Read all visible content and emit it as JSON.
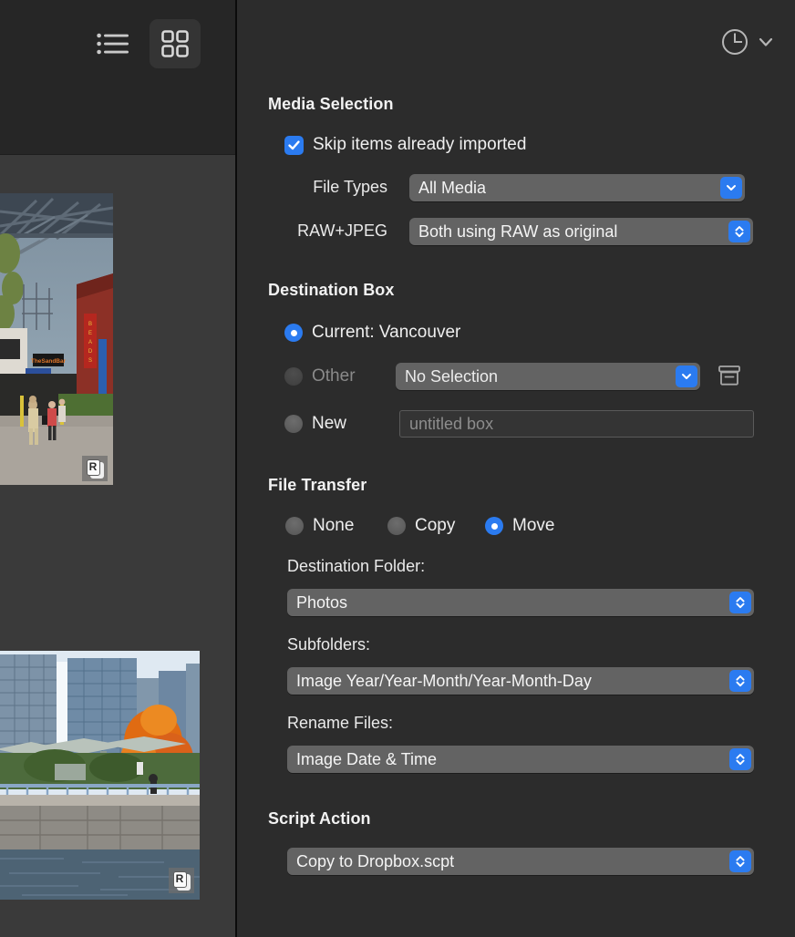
{
  "sidebar": {
    "view_toggle": {
      "list_icon": "list-view-icon",
      "grid_icon": "grid-view-icon",
      "selected": "grid"
    },
    "thumbnails": [
      {
        "name": "granville-island-street-scene",
        "raw_badge": "R"
      },
      {
        "name": "vancouver-seawall-towers",
        "raw_badge": "R"
      }
    ]
  },
  "panel": {
    "history_button": {
      "icon": "clock-icon",
      "chevron": "chevron-down-icon"
    },
    "media_selection": {
      "title": "Media Selection",
      "skip_checkbox": {
        "label": "Skip items already imported",
        "checked": true
      },
      "file_types": {
        "label": "File Types",
        "value": "All Media",
        "arrow": "chevron-down-icon"
      },
      "raw_jpeg": {
        "label": "RAW+JPEG",
        "value": "Both using RAW as original",
        "arrow": "up-down-chevron-icon"
      }
    },
    "destination_box": {
      "title": "Destination Box",
      "current": {
        "label": "Current: Vancouver",
        "selected": true
      },
      "other": {
        "label": "Other",
        "selected": false,
        "disabled": true,
        "value": "No Selection",
        "arrow": "chevron-down-icon",
        "archive_icon": "archive-box-icon"
      },
      "new": {
        "label": "New",
        "selected": false,
        "placeholder": "untitled box",
        "value": ""
      }
    },
    "file_transfer": {
      "title": "File Transfer",
      "options": [
        {
          "label": "None",
          "selected": false
        },
        {
          "label": "Copy",
          "selected": false
        },
        {
          "label": "Move",
          "selected": true
        }
      ],
      "destination_folder": {
        "label": "Destination Folder:",
        "value": "Photos",
        "arrow": "up-down-chevron-icon"
      },
      "subfolders": {
        "label": "Subfolders:",
        "value": "Image Year/Year-Month/Year-Month-Day",
        "arrow": "up-down-chevron-icon"
      },
      "rename_files": {
        "label": "Rename Files:",
        "value": "Image Date & Time",
        "arrow": "up-down-chevron-icon"
      }
    },
    "script_action": {
      "title": "Script Action",
      "script": {
        "value": "Copy to Dropbox.scpt",
        "arrow": "up-down-chevron-icon"
      }
    }
  },
  "colors": {
    "accent": "#2b7bf0",
    "panel_bg": "#2c2c2c",
    "sidebar_bg": "#3a3a3a",
    "toolbar_bg": "#262626",
    "control_bg": "#636363"
  }
}
